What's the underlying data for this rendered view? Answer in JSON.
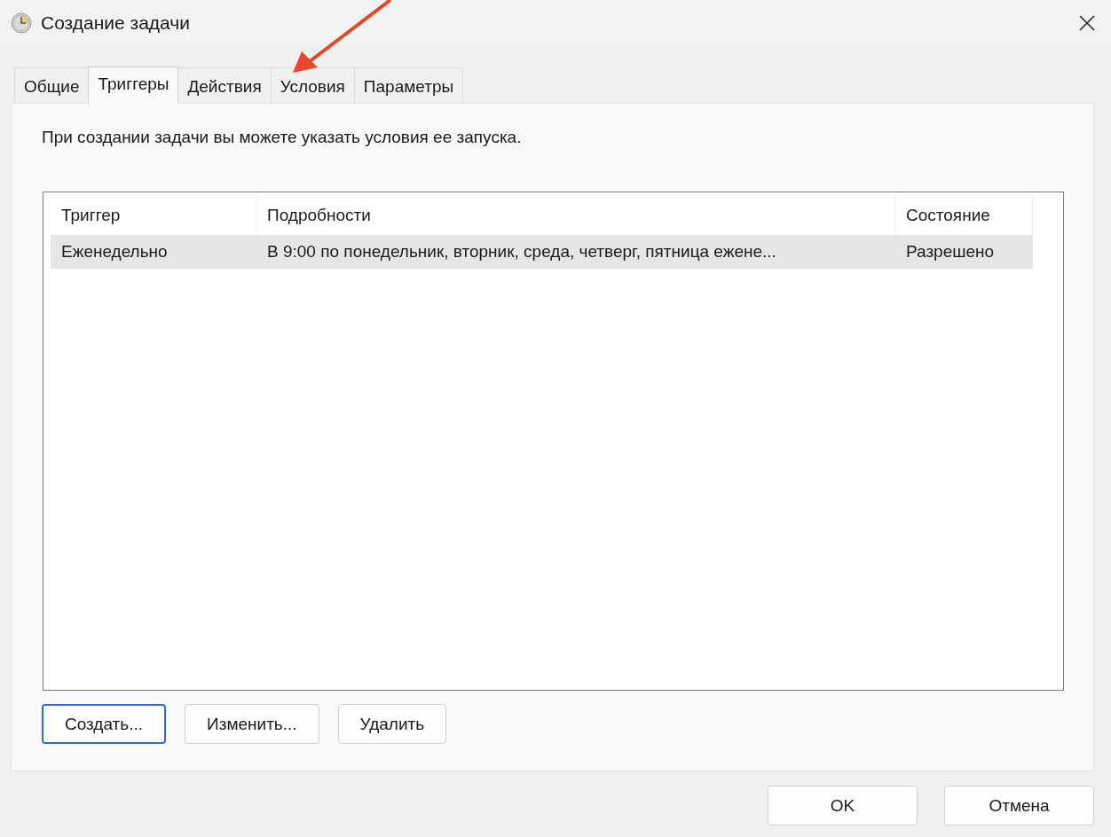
{
  "window": {
    "title": "Создание задачи"
  },
  "tabs": [
    {
      "label": "Общие",
      "selected": false
    },
    {
      "label": "Триггеры",
      "selected": true
    },
    {
      "label": "Действия",
      "selected": false
    },
    {
      "label": "Условия",
      "selected": false
    },
    {
      "label": "Параметры",
      "selected": false
    }
  ],
  "description": "При создании задачи вы можете указать условия ее запуска.",
  "table": {
    "columns": [
      "Триггер",
      "Подробности",
      "Состояние"
    ],
    "rows": [
      {
        "cells": [
          "Еженедельно",
          "В 9:00 по понедельник, вторник, среда, четверг, пятница ежене...",
          "Разрешено"
        ],
        "selected": true
      }
    ]
  },
  "table_buttons": [
    {
      "label": "Создать...",
      "focused": true
    },
    {
      "label": "Изменить...",
      "focused": false
    },
    {
      "label": "Удалить",
      "focused": false
    }
  ],
  "dialog_buttons": [
    {
      "label": "OK"
    },
    {
      "label": "Отмена"
    }
  ]
}
